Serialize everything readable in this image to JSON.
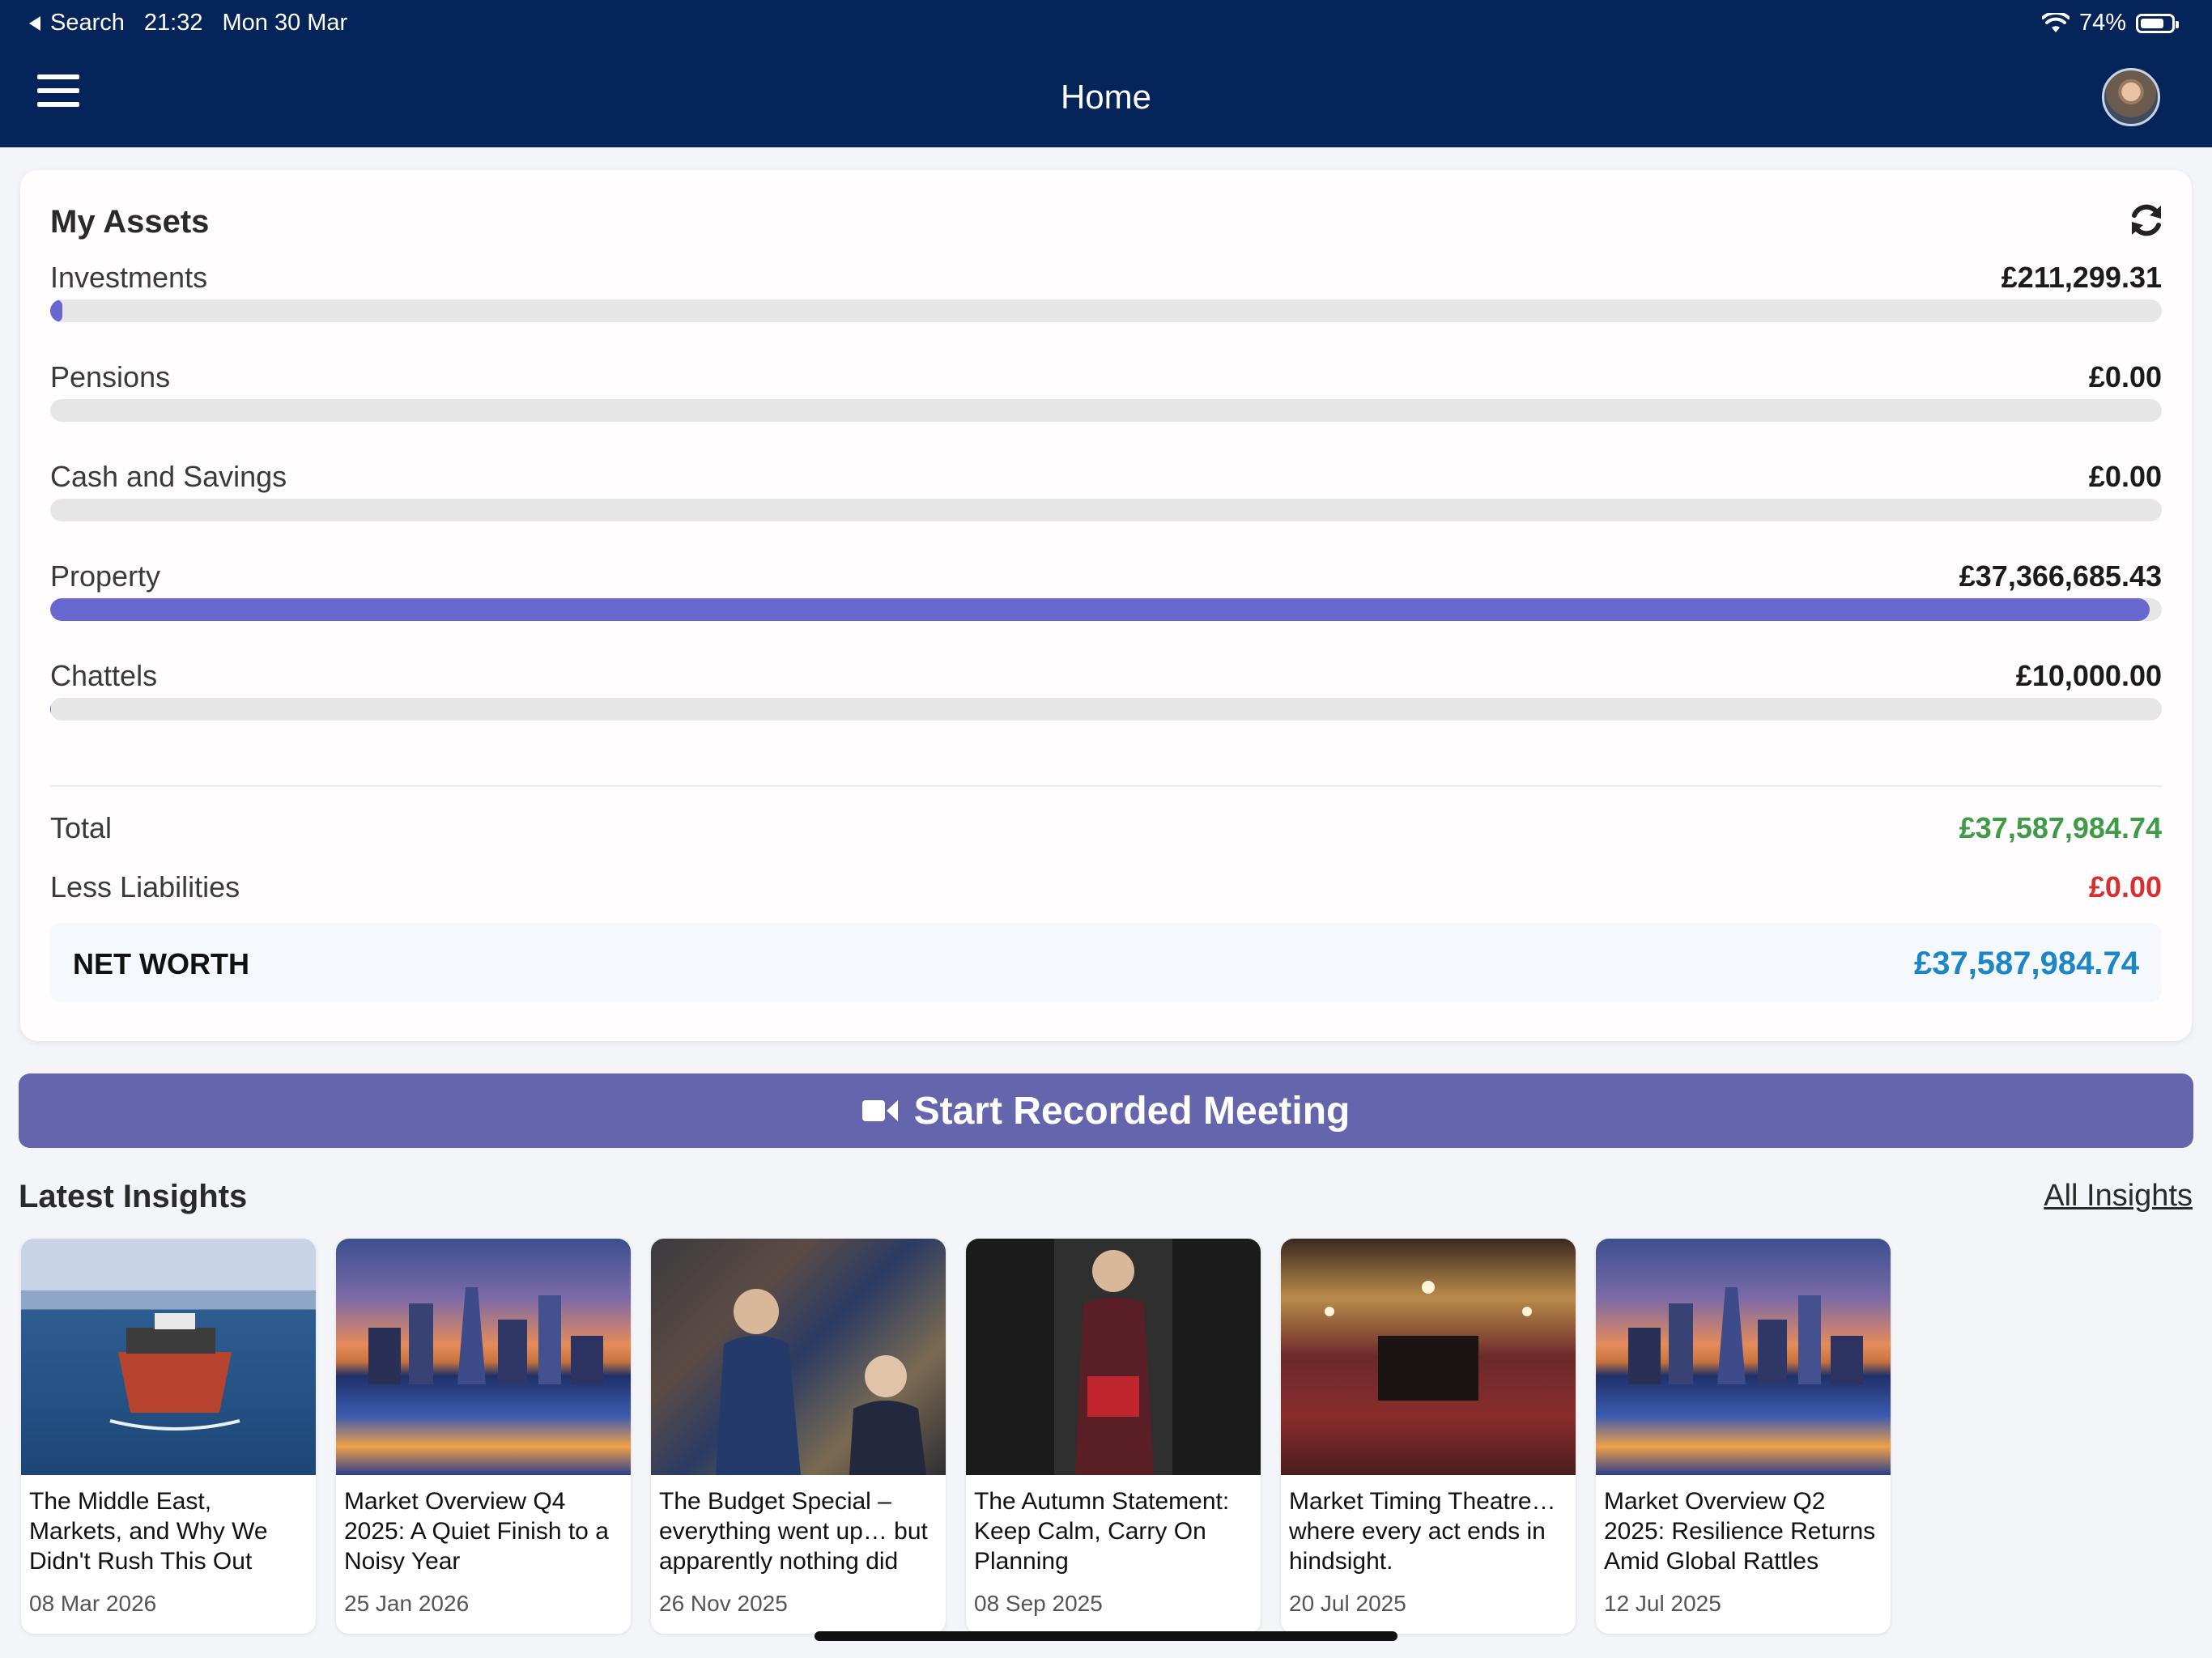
{
  "status_bar": {
    "back_label": "Search",
    "time": "21:32",
    "date": "Mon 30 Mar",
    "battery": "74%"
  },
  "header": {
    "title": "Home"
  },
  "assets": {
    "title": "My Assets",
    "rows": [
      {
        "label": "Investments",
        "value": "£211,299.31",
        "fill_fraction": 0.0056
      },
      {
        "label": "Pensions",
        "value": "£0.00",
        "fill_fraction": 0
      },
      {
        "label": "Cash and Savings",
        "value": "£0.00",
        "fill_fraction": 0
      },
      {
        "label": "Property",
        "value": "£37,366,685.43",
        "fill_fraction": 0.9941
      },
      {
        "label": "Chattels",
        "value": "£10,000.00",
        "fill_fraction": 0.0003
      }
    ],
    "total_label": "Total",
    "total_value": "£37,587,984.74",
    "liabilities_label": "Less Liabilities",
    "liabilities_value": "£0.00",
    "networth_label": "NET WORTH",
    "networth_value": "£37,587,984.74",
    "accent_color": "#6767cf"
  },
  "meeting_button": {
    "label": "Start Recorded Meeting"
  },
  "insights": {
    "title": "Latest Insights",
    "all_link": "All Insights",
    "cards": [
      {
        "title": "The Middle East, Markets, and Why We Didn't Rush This Out",
        "date": "08 Mar 2026",
        "image": "tanker-ship"
      },
      {
        "title": "Market Overview Q4 2025: A Quiet Finish to a Noisy Year",
        "date": "25 Jan 2026",
        "image": "city-skyline"
      },
      {
        "title": "The Budget Special – everything went up… but apparently nothing did",
        "date": "26 Nov 2025",
        "image": "house-of-commons"
      },
      {
        "title": "The Autumn Statement: Keep Calm, Carry On Planning",
        "date": "08 Sep 2025",
        "image": "downing-street"
      },
      {
        "title": "Market Timing Theatre… where every act ends in hindsight.",
        "date": "20 Jul 2025",
        "image": "theatre-interior"
      },
      {
        "title": "Market Overview Q2 2025: Resilience Returns Amid Global Rattles",
        "date": "12 Jul 2025",
        "image": "city-skyline"
      }
    ]
  }
}
